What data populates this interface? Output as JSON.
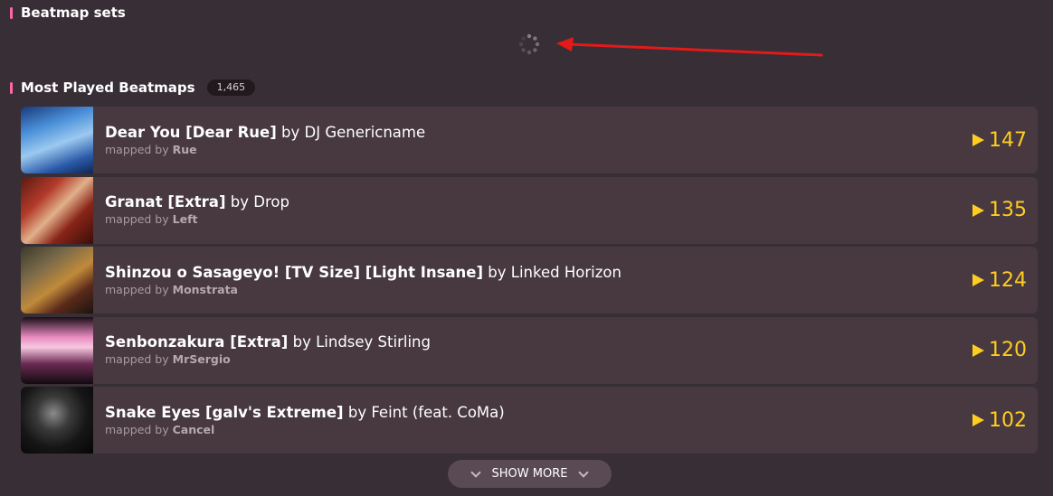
{
  "sections": {
    "beatmap_sets": {
      "title": "Beatmap sets"
    },
    "most_played": {
      "title": "Most Played Beatmaps",
      "count": "1,465"
    }
  },
  "colors": {
    "accent": "#ff66aa",
    "playcount": "#ffcc22",
    "annotation_arrow": "#e21a1a"
  },
  "icons": {
    "loading": "spinner-icon",
    "play": "play-icon",
    "expand": "chevron-down-icon"
  },
  "beatmaps": [
    {
      "title": "Dear You [Dear Rue]",
      "by_label": "by",
      "artist": "DJ Genericname",
      "mapped_by_label": "mapped by",
      "mapper": "Rue",
      "playcount": "147"
    },
    {
      "title": "Granat [Extra]",
      "by_label": "by",
      "artist": "Drop",
      "mapped_by_label": "mapped by",
      "mapper": "Left",
      "playcount": "135"
    },
    {
      "title": "Shinzou o Sasageyo! [TV Size] [Light Insane]",
      "by_label": "by",
      "artist": "Linked Horizon",
      "mapped_by_label": "mapped by",
      "mapper": "Monstrata",
      "playcount": "124"
    },
    {
      "title": "Senbonzakura [Extra]",
      "by_label": "by",
      "artist": "Lindsey Stirling",
      "mapped_by_label": "mapped by",
      "mapper": "MrSergio",
      "playcount": "120"
    },
    {
      "title": "Snake Eyes [galv's Extreme]",
      "by_label": "by",
      "artist": "Feint (feat. CoMa)",
      "mapped_by_label": "mapped by",
      "mapper": "Cancel",
      "playcount": "102"
    }
  ],
  "show_more": {
    "label": "SHOW MORE"
  }
}
